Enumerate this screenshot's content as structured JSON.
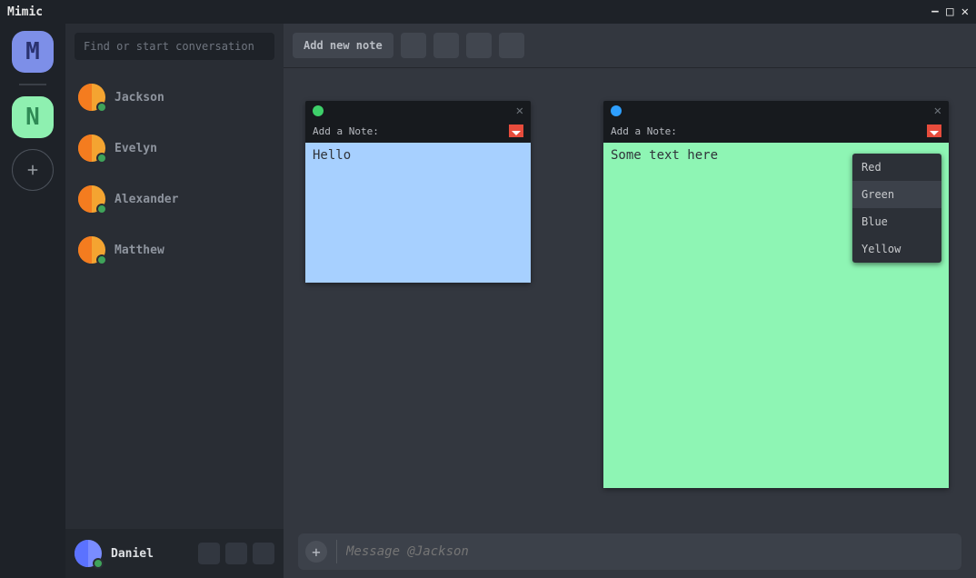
{
  "window": {
    "title": "Mimic"
  },
  "rail": {
    "guilds": [
      {
        "letter": "M",
        "bg": "#7d8fe8",
        "fg": "#2a3270"
      },
      {
        "letter": "N",
        "bg": "#8ef0b0",
        "fg": "#2f8a55"
      }
    ]
  },
  "sidebar": {
    "search_placeholder": "Find or start conversation",
    "dms": [
      {
        "name": "Jackson"
      },
      {
        "name": "Evelyn"
      },
      {
        "name": "Alexander"
      },
      {
        "name": "Matthew"
      }
    ],
    "self": {
      "name": "Daniel"
    }
  },
  "toolbar": {
    "add_note": "Add new note"
  },
  "notes": {
    "label": "Add a Note:",
    "note1_text": "Hello",
    "note2_text": "Some text here"
  },
  "color_menu": {
    "options": [
      "Red",
      "Green",
      "Blue",
      "Yellow"
    ],
    "selected_index": 1
  },
  "composer": {
    "placeholder": "Message @Jackson"
  }
}
